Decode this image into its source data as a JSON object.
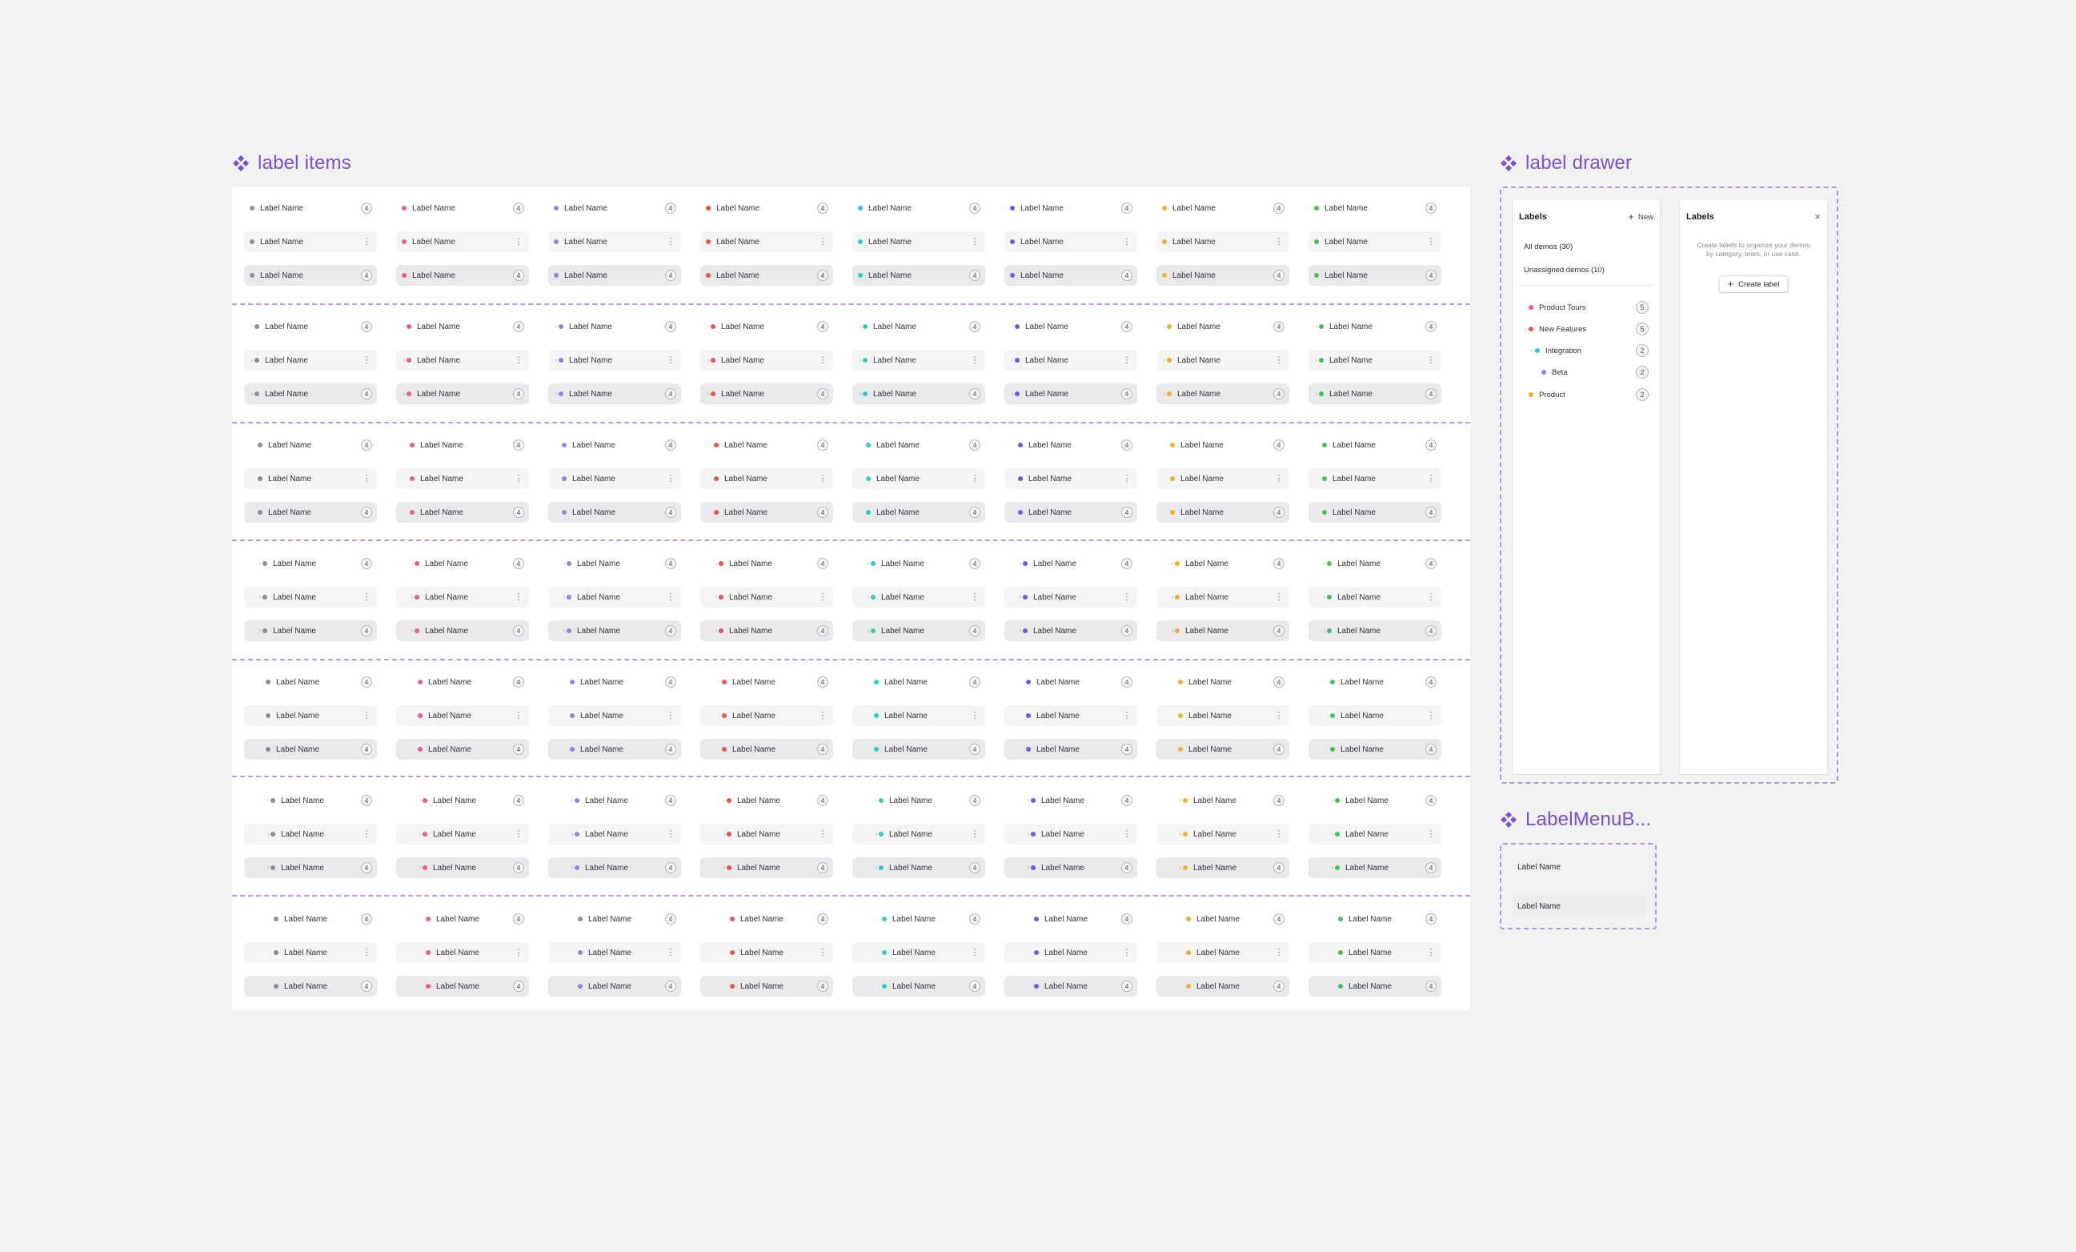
{
  "sections": {
    "label_items": "label items",
    "label_drawer": "label drawer",
    "label_menu_button": "LabelMenuB..."
  },
  "label_items": {
    "label_text": "Label Name",
    "count": "4",
    "kebab_icon": "more-vertical-icon",
    "colors": [
      "#8e8e95",
      "#ef5c8c",
      "#8d84ea",
      "#ef5252",
      "#2ecfc2",
      "#6a5cf0",
      "#f2b02d",
      "#44c258"
    ],
    "color_names": [
      "gray",
      "pink",
      "lavender",
      "red",
      "teal",
      "violet",
      "amber",
      "green"
    ],
    "states": [
      "default",
      "hover",
      "active"
    ],
    "groups": [
      {
        "indent": 0,
        "chevron": false
      },
      {
        "indent": 0,
        "chevron": true
      },
      {
        "indent": 1,
        "chevron": false
      },
      {
        "indent": 1,
        "chevron": true
      },
      {
        "indent": 2,
        "chevron": false
      },
      {
        "indent": 2,
        "chevron": true
      },
      {
        "indent": 3,
        "chevron": false
      }
    ]
  },
  "drawer": {
    "panel_title": "Labels",
    "new_label": "New",
    "nav": [
      "All demos (30)",
      "Unassigned demos (10)"
    ],
    "tree": [
      {
        "label": "Product Tours",
        "count": "5",
        "color": "#ef5c8c",
        "level": 0,
        "chevron": false
      },
      {
        "label": "New Features",
        "count": "5",
        "color": "#ef5252",
        "level": 0,
        "chevron": true
      },
      {
        "label": "Integration",
        "count": "2",
        "color": "#2ecfc2",
        "level": 1,
        "chevron": true
      },
      {
        "label": "Beta",
        "count": "2",
        "color": "#8d84ea",
        "level": 2,
        "chevron": false
      },
      {
        "label": "Product",
        "count": "2",
        "color": "#f2b02d",
        "level": 0,
        "chevron": false
      }
    ],
    "empty_title": "Labels",
    "empty_text_line1": "Create labels to organize your demos",
    "empty_text_line2": "by category, team, or use case.",
    "create_label": "Create label"
  },
  "menu_button": {
    "items": [
      {
        "label": "Label Name",
        "state": "default"
      },
      {
        "label": "Label Name",
        "state": "active"
      }
    ]
  }
}
